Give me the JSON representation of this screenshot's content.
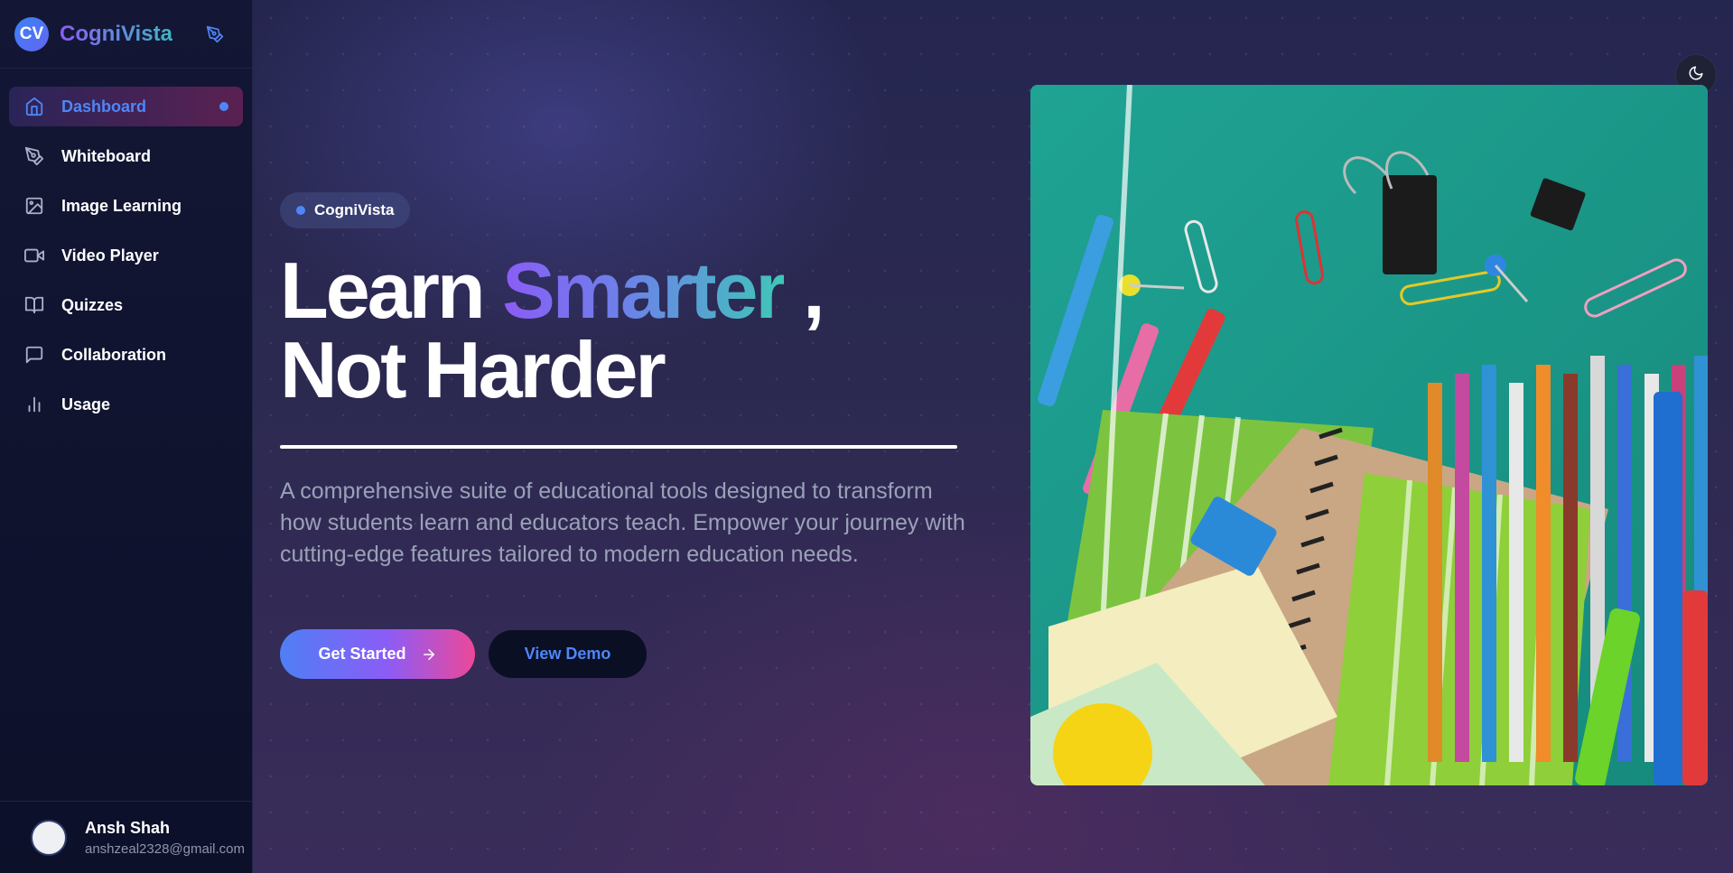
{
  "brand": {
    "logo": "CV",
    "name": "CogniVista"
  },
  "sidebar": {
    "items": [
      {
        "label": "Dashboard",
        "icon": "home-icon",
        "active": true
      },
      {
        "label": "Whiteboard",
        "icon": "pen-icon"
      },
      {
        "label": "Image Learning",
        "icon": "image-icon"
      },
      {
        "label": "Video Player",
        "icon": "video-icon"
      },
      {
        "label": "Quizzes",
        "icon": "book-icon"
      },
      {
        "label": "Collaboration",
        "icon": "message-icon"
      },
      {
        "label": "Usage",
        "icon": "bar-chart-icon"
      }
    ]
  },
  "user": {
    "name": "Ansh Shah",
    "email": "anshzeal2328@gmail.com"
  },
  "hero": {
    "tag": "CogniVista",
    "headline_pre": "Learn ",
    "headline_highlight": "Smarter",
    "headline_post": " ,",
    "headline_line2": "Not Harder",
    "description": "A comprehensive suite of educational tools designed to transform how students learn and educators teach. Empower your journey with cutting-edge features tailored to modern education needs.",
    "primary_button": "Get Started",
    "secondary_button": "View Demo"
  },
  "colors": {
    "accent": "#4f86f7",
    "gradient_start": "#8b5cf6",
    "gradient_end": "#3fc7b8",
    "pink": "#ec4899"
  },
  "icons": {
    "theme_toggle": "moon-icon",
    "brand_action": "pen-icon",
    "button_arrow": "arrow-right-icon"
  }
}
